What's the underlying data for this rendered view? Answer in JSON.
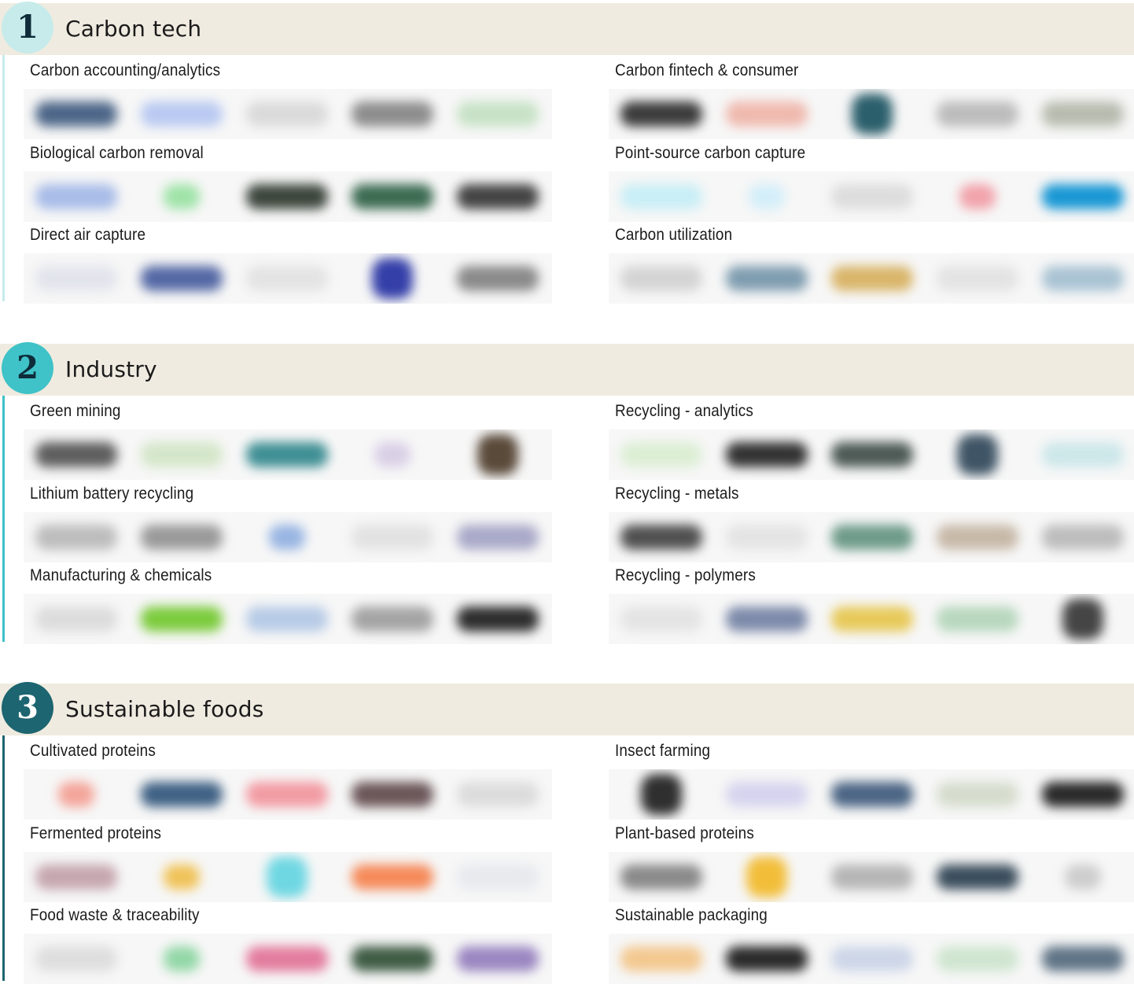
{
  "sections": [
    {
      "number": "1",
      "title": "Carbon tech",
      "badge_bg": "#c6ebea",
      "badge_fg": "#0e2c3a",
      "rail_color": "#c6ebea",
      "categories": [
        {
          "label": "Carbon accounting/analytics",
          "logos": [
            {
              "color": "#4d6688",
              "shape": "wide"
            },
            {
              "color": "#b9c9f1",
              "shape": "wide"
            },
            {
              "color": "#dadada",
              "shape": "wide"
            },
            {
              "color": "#8d8d8d",
              "shape": "wide"
            },
            {
              "color": "#c7e2c6",
              "shape": "wide"
            }
          ]
        },
        {
          "label": "Carbon fintech & consumer",
          "logos": [
            {
              "color": "#3c3c3c",
              "shape": "wide"
            },
            {
              "color": "#efb9ae",
              "shape": "wide"
            },
            {
              "color": "#2b5f6c",
              "shape": "round"
            },
            {
              "color": "#bcbcbc",
              "shape": "wide"
            },
            {
              "color": "#b8bcaf",
              "shape": "wide"
            }
          ]
        },
        {
          "label": "Biological carbon removal",
          "logos": [
            {
              "color": "#a8bce8",
              "shape": "wide"
            },
            {
              "color": "#9fe3a8",
              "shape": "small"
            },
            {
              "color": "#3d463d",
              "shape": "wide"
            },
            {
              "color": "#3c6b52",
              "shape": "wide"
            },
            {
              "color": "#444444",
              "shape": "wide"
            }
          ]
        },
        {
          "label": "Point-source carbon capture",
          "logos": [
            {
              "color": "#c8eef6",
              "shape": "wide"
            },
            {
              "color": "#d3eef9",
              "shape": "small"
            },
            {
              "color": "#dddddd",
              "shape": "wide"
            },
            {
              "color": "#f1a3ab",
              "shape": "small"
            },
            {
              "color": "#1997d4",
              "shape": "wide"
            }
          ]
        },
        {
          "label": "Direct air capture",
          "logos": [
            {
              "color": "#e2e4ec",
              "shape": "wide"
            },
            {
              "color": "#5468a5",
              "shape": "wide"
            },
            {
              "color": "#e3e3e3",
              "shape": "wide"
            },
            {
              "color": "#343fa8",
              "shape": "round"
            },
            {
              "color": "#8a8a8a",
              "shape": "wide"
            }
          ]
        },
        {
          "label": "Carbon utilization",
          "logos": [
            {
              "color": "#d4d4d4",
              "shape": "wide"
            },
            {
              "color": "#7f9db0",
              "shape": "wide"
            },
            {
              "color": "#d9b56a",
              "shape": "wide"
            },
            {
              "color": "#e3e3e3",
              "shape": "wide"
            },
            {
              "color": "#a9c3d3",
              "shape": "wide"
            }
          ]
        }
      ]
    },
    {
      "number": "2",
      "title": "Industry",
      "badge_bg": "#3fc2c8",
      "badge_fg": "#0e2c3a",
      "rail_color": "#3fc2c8",
      "categories": [
        {
          "label": "Green mining",
          "logos": [
            {
              "color": "#5e5e5e",
              "shape": "wide"
            },
            {
              "color": "#d4e6c9",
              "shape": "wide"
            },
            {
              "color": "#3f8f94",
              "shape": "wide"
            },
            {
              "color": "#d9cfe6",
              "shape": "small"
            },
            {
              "color": "#5a4a3a",
              "shape": "round"
            }
          ]
        },
        {
          "label": "Recycling - analytics",
          "logos": [
            {
              "color": "#dceed4",
              "shape": "wide"
            },
            {
              "color": "#333333",
              "shape": "wide"
            },
            {
              "color": "#4d5a55",
              "shape": "wide"
            },
            {
              "color": "#3f5566",
              "shape": "round"
            },
            {
              "color": "#cde7ea",
              "shape": "wide"
            }
          ]
        },
        {
          "label": "Lithium battery recycling",
          "logos": [
            {
              "color": "#bdbdbd",
              "shape": "wide"
            },
            {
              "color": "#9a9a9a",
              "shape": "wide"
            },
            {
              "color": "#98b5e2",
              "shape": "small"
            },
            {
              "color": "#e2e2e2",
              "shape": "wide"
            },
            {
              "color": "#a9a9c9",
              "shape": "wide"
            }
          ]
        },
        {
          "label": "Recycling - metals",
          "logos": [
            {
              "color": "#505050",
              "shape": "wide"
            },
            {
              "color": "#e4e4e4",
              "shape": "wide"
            },
            {
              "color": "#6e9b8a",
              "shape": "wide"
            },
            {
              "color": "#c7b9a8",
              "shape": "wide"
            },
            {
              "color": "#bdbdbd",
              "shape": "wide"
            }
          ]
        },
        {
          "label": "Manufacturing & chemicals",
          "logos": [
            {
              "color": "#dcdcdc",
              "shape": "wide"
            },
            {
              "color": "#7ccb3d",
              "shape": "wide"
            },
            {
              "color": "#b7cbe6",
              "shape": "wide"
            },
            {
              "color": "#a4a4a4",
              "shape": "wide"
            },
            {
              "color": "#2e2e2e",
              "shape": "wide"
            }
          ]
        },
        {
          "label": "Recycling - polymers",
          "logos": [
            {
              "color": "#e4e4e4",
              "shape": "wide"
            },
            {
              "color": "#7d8aaa",
              "shape": "wide"
            },
            {
              "color": "#e7c95a",
              "shape": "wide"
            },
            {
              "color": "#b7d7bd",
              "shape": "wide"
            },
            {
              "color": "#454545",
              "shape": "round"
            }
          ]
        }
      ]
    },
    {
      "number": "3",
      "title": "Sustainable foods",
      "badge_bg": "#1d6570",
      "badge_fg": "#ffffff",
      "rail_color": "#1d6570",
      "categories": [
        {
          "label": "Cultivated proteins",
          "logos": [
            {
              "color": "#f4a59a",
              "shape": "small"
            },
            {
              "color": "#3f6184",
              "shape": "wide"
            },
            {
              "color": "#f29ba3",
              "shape": "wide"
            },
            {
              "color": "#6b5658",
              "shape": "wide"
            },
            {
              "color": "#dcdcdc",
              "shape": "wide"
            }
          ]
        },
        {
          "label": "Insect farming",
          "logos": [
            {
              "color": "#2f2f2f",
              "shape": "round"
            },
            {
              "color": "#d6d4ee",
              "shape": "wide"
            },
            {
              "color": "#4b6584",
              "shape": "wide"
            },
            {
              "color": "#d5dccd",
              "shape": "wide"
            },
            {
              "color": "#2a2a2a",
              "shape": "wide"
            }
          ]
        },
        {
          "label": "Fermented proteins",
          "logos": [
            {
              "color": "#c6a7b0",
              "shape": "wide"
            },
            {
              "color": "#f0c35a",
              "shape": "small"
            },
            {
              "color": "#6fd7e2",
              "shape": "round"
            },
            {
              "color": "#f58a5a",
              "shape": "wide"
            },
            {
              "color": "#e7e9ee",
              "shape": "wide"
            }
          ]
        },
        {
          "label": "Plant-based proteins",
          "logos": [
            {
              "color": "#8a8a8a",
              "shape": "wide"
            },
            {
              "color": "#f2be3a",
              "shape": "round"
            },
            {
              "color": "#b6b6b6",
              "shape": "wide"
            },
            {
              "color": "#3b4e5d",
              "shape": "wide"
            },
            {
              "color": "#cdcdcd",
              "shape": "small"
            }
          ]
        },
        {
          "label": "Food waste & traceability",
          "logos": [
            {
              "color": "#dedede",
              "shape": "wide"
            },
            {
              "color": "#93d7a7",
              "shape": "small"
            },
            {
              "color": "#e37c9e",
              "shape": "wide"
            },
            {
              "color": "#3f5c45",
              "shape": "wide"
            },
            {
              "color": "#9a86c1",
              "shape": "wide"
            }
          ]
        },
        {
          "label": "Sustainable packaging",
          "logos": [
            {
              "color": "#f3c890",
              "shape": "wide"
            },
            {
              "color": "#2b2b2b",
              "shape": "wide"
            },
            {
              "color": "#cdd6e8",
              "shape": "wide"
            },
            {
              "color": "#cfe5d0",
              "shape": "wide"
            },
            {
              "color": "#5f7486",
              "shape": "wide"
            }
          ]
        }
      ]
    }
  ]
}
